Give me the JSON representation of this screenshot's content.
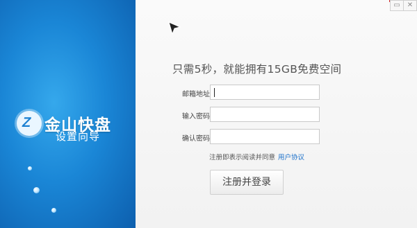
{
  "window": {
    "minimize": "▭",
    "close": "✕"
  },
  "sidebar": {
    "brand_name": "金山快盘",
    "subtitle": "设置向导",
    "logo_letter": "Z",
    "colors": {
      "top": "#35a8ec",
      "bottom": "#0d5fae"
    }
  },
  "form": {
    "headline": "只需5秒，就能拥有15GB免费空间",
    "email_label": "邮箱地址:",
    "password_label": "输入密码:",
    "confirm_label": "确认密码:",
    "email_value": "",
    "password_value": "",
    "confirm_value": "",
    "agree_text": "注册即表示阅读并同意",
    "agree_link": "用户协议",
    "submit_label": "注册并登录"
  },
  "colors": {
    "link": "#1a6fc9",
    "accent_red": "#d42b2b"
  }
}
